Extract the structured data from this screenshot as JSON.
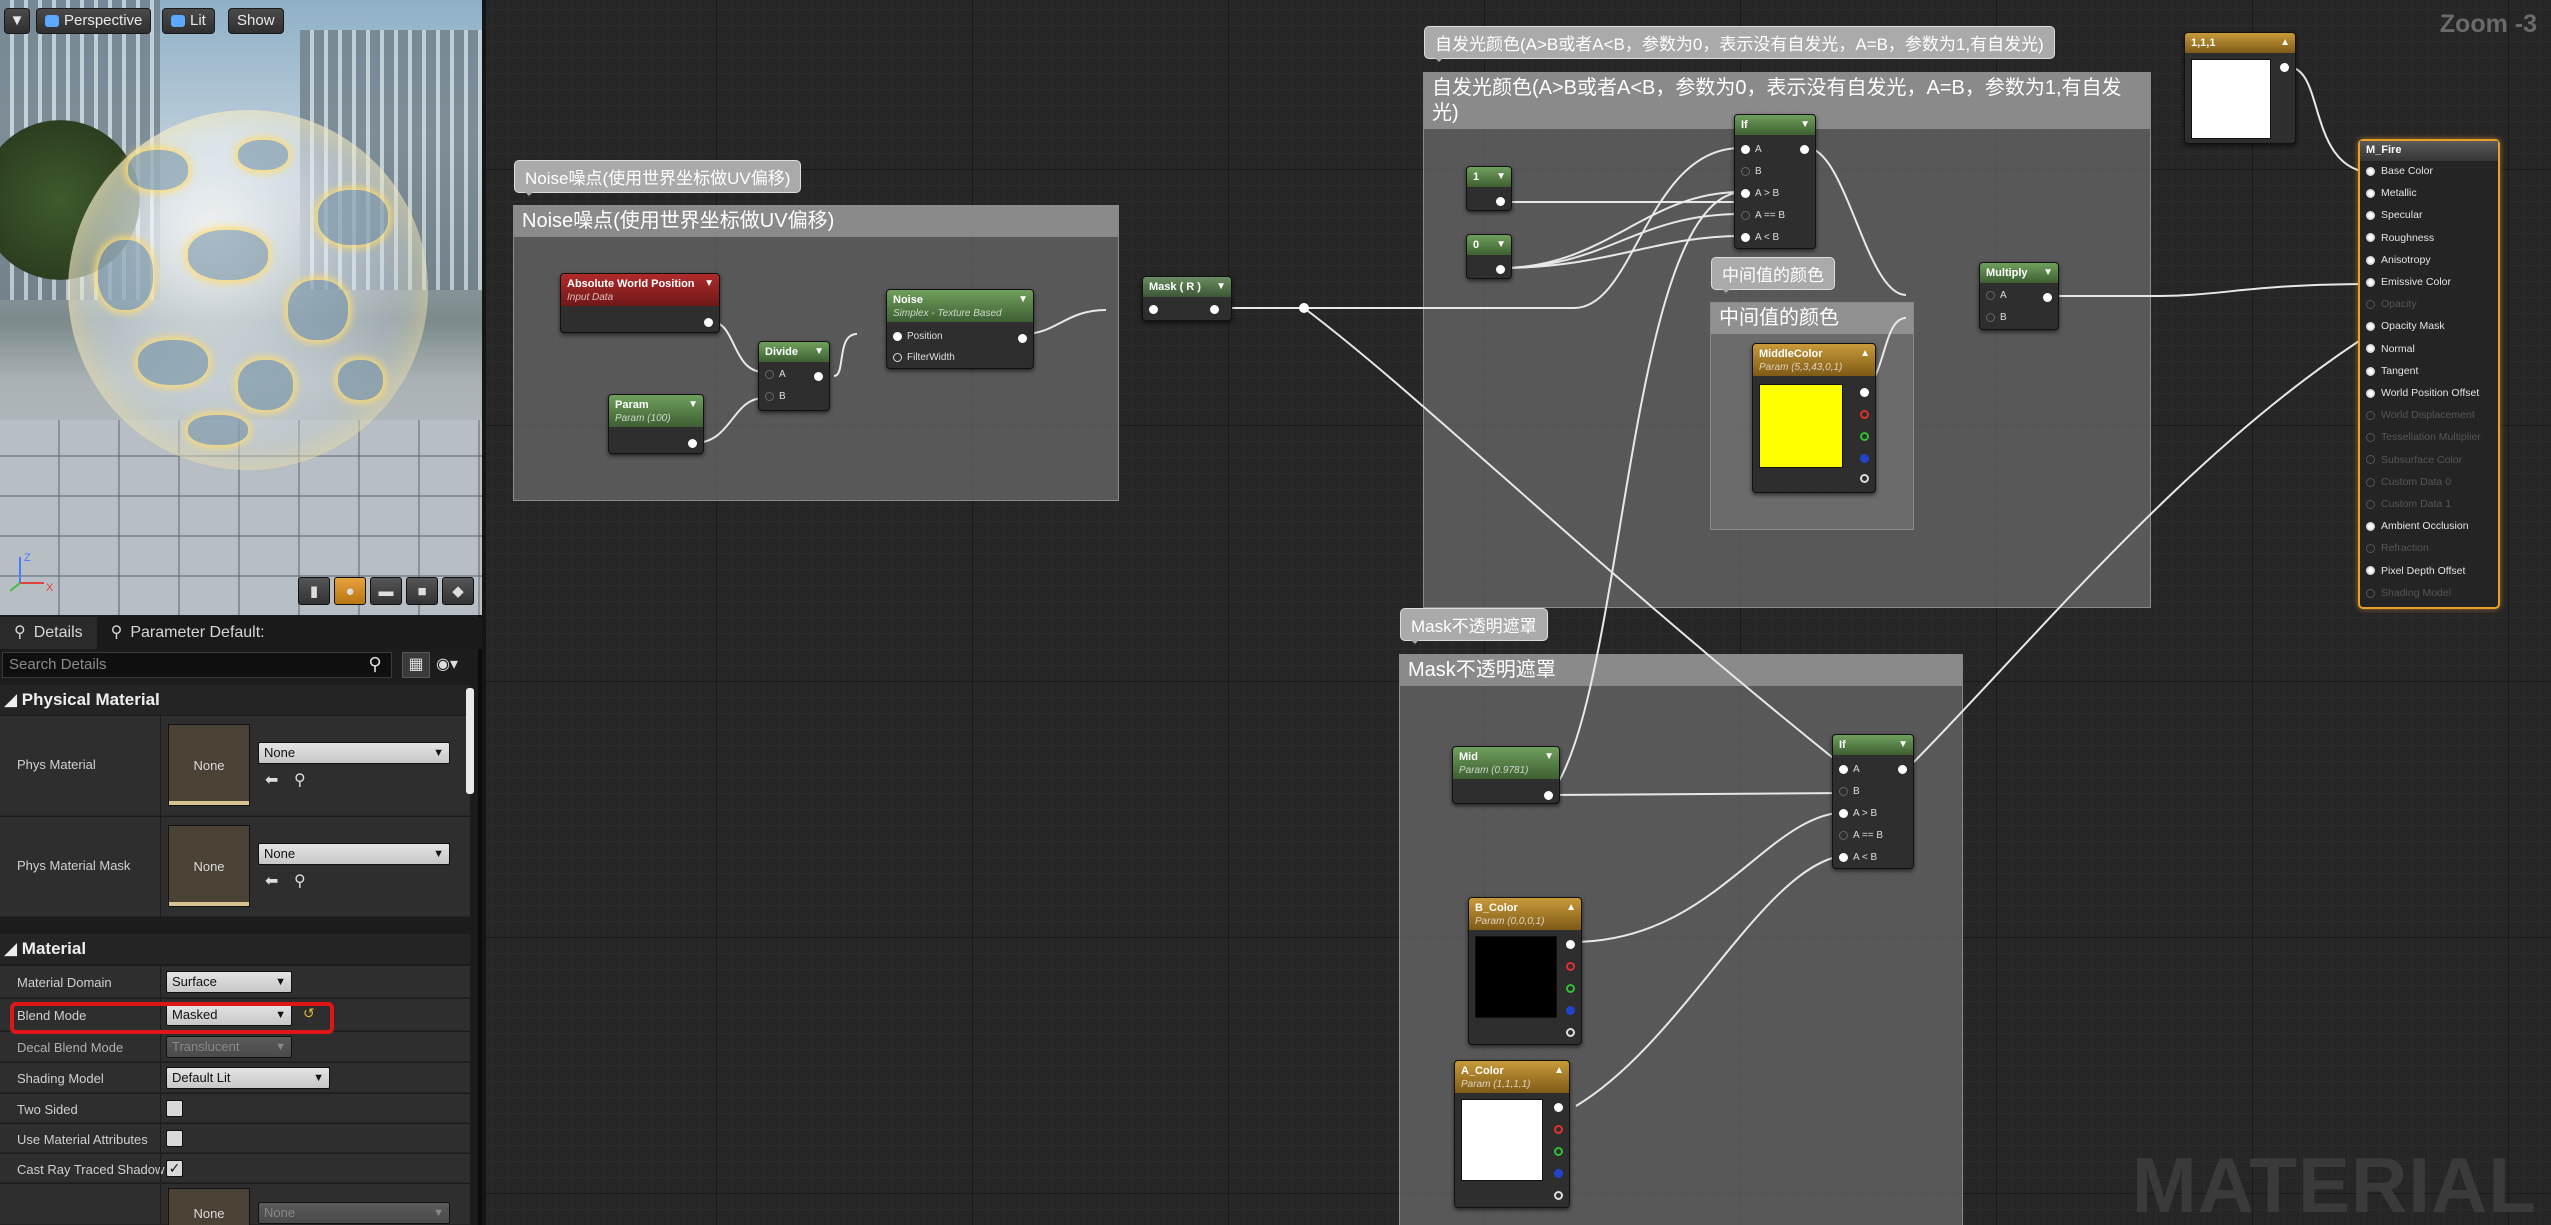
{
  "viewport": {
    "buttons": {
      "menu": "▼",
      "perspective": "Perspective",
      "lit": "Lit",
      "show": "Show"
    },
    "axes": {
      "z": "Z",
      "x": "X"
    }
  },
  "details": {
    "tabs": [
      {
        "label": "Details",
        "icon": "magnifier-icon"
      },
      {
        "label": "Parameter Default:",
        "icon": "magnifier-icon"
      }
    ],
    "search_placeholder": "Search Details",
    "physical_material": {
      "title": "Physical Material",
      "rows": [
        {
          "label": "Phys Material",
          "thumb": "None",
          "value": "None"
        },
        {
          "label": "Phys Material Mask",
          "thumb": "None",
          "value": "None"
        }
      ]
    },
    "material": {
      "title": "Material",
      "material_domain": {
        "label": "Material Domain",
        "value": "Surface"
      },
      "blend_mode": {
        "label": "Blend Mode",
        "value": "Masked",
        "reset": "↺"
      },
      "decal_blend_mode": {
        "label": "Decal Blend Mode",
        "value": "Translucent"
      },
      "shading_model": {
        "label": "Shading Model",
        "value": "Default Lit"
      },
      "two_sided": {
        "label": "Two Sided",
        "checked": false
      },
      "use_material_attributes": {
        "label": "Use Material Attributes",
        "checked": false
      },
      "cast_ray_traced_shadows": {
        "label": "Cast Ray Traced Shadow",
        "checked": true,
        "mark": "✓"
      },
      "partial_row": {
        "thumb": "None",
        "value": "None"
      }
    }
  },
  "graph": {
    "zoom": "Zoom -3",
    "watermark": "MATERIAL",
    "comments": {
      "noise": {
        "tag": "Noise噪点(使用世界坐标做UV偏移)",
        "header": "Noise噪点(使用世界坐标做UV偏移)"
      },
      "emissive": {
        "tag": "自发光颜色(A>B或者A<B，参数为0，表示没有自发光，A=B，参数为1,有自发光)",
        "header": "自发光颜色(A>B或者A<B，参数为0，表示没有自发光，A=B，参数为1,有自发光)"
      },
      "middle": {
        "tag": "中间值的颜色",
        "header": "中间值的颜色"
      },
      "mask": {
        "tag": "Mask不透明遮罩",
        "header": "Mask不透明遮罩"
      }
    },
    "nodes": {
      "abs_world_pos": {
        "title": "Absolute World Position",
        "sub": "Input Data"
      },
      "param": {
        "title": "Param",
        "sub": "Param (100)"
      },
      "divide": {
        "title": "Divide",
        "pins": [
          "A",
          "B"
        ]
      },
      "noise": {
        "title": "Noise",
        "sub": "Simplex - Texture Based",
        "pins": [
          "Position",
          "FilterWidth"
        ]
      },
      "mask_r": {
        "title": "Mask ( R )"
      },
      "const_1": {
        "title": "1"
      },
      "const_0": {
        "title": "0"
      },
      "if_top": {
        "title": "If",
        "pins": [
          "A",
          "B",
          "A > B",
          "A == B",
          "A < B"
        ]
      },
      "multiply": {
        "title": "Multiply",
        "pins": [
          "A",
          "B"
        ]
      },
      "middle_color": {
        "title": "MiddleColor",
        "sub": "Param (5,3,43,0,1)",
        "swatch": "#ffff00"
      },
      "const_111": {
        "title": "1,1,1",
        "swatch": "#ffffff"
      },
      "mid": {
        "title": "Mid",
        "sub": "Param (0.9781)"
      },
      "b_color": {
        "title": "B_Color",
        "sub": "Param (0,0,0,1)",
        "swatch": "#000000"
      },
      "a_color": {
        "title": "A_Color",
        "sub": "Param (1,1,1,1)",
        "swatch": "#ffffff"
      },
      "if_bottom": {
        "title": "If",
        "pins": [
          "A",
          "B",
          "A > B",
          "A == B",
          "A < B"
        ]
      }
    },
    "result": {
      "title": "M_Fire",
      "pins": [
        {
          "label": "Base Color",
          "active": true
        },
        {
          "label": "Metallic",
          "active": true
        },
        {
          "label": "Specular",
          "active": true
        },
        {
          "label": "Roughness",
          "active": true
        },
        {
          "label": "Anisotropy",
          "active": true
        },
        {
          "label": "Emissive Color",
          "active": true
        },
        {
          "label": "Opacity",
          "active": false
        },
        {
          "label": "Opacity Mask",
          "active": true
        },
        {
          "label": "Normal",
          "active": true
        },
        {
          "label": "Tangent",
          "active": true
        },
        {
          "label": "World Position Offset",
          "active": true
        },
        {
          "label": "World Displacement",
          "active": false
        },
        {
          "label": "Tessellation Multiplier",
          "active": false
        },
        {
          "label": "Subsurface Color",
          "active": false
        },
        {
          "label": "Custom Data 0",
          "active": false
        },
        {
          "label": "Custom Data 1",
          "active": false
        },
        {
          "label": "Ambient Occlusion",
          "active": true
        },
        {
          "label": "Refraction",
          "active": false
        },
        {
          "label": "Pixel Depth Offset",
          "active": true
        },
        {
          "label": "Shading Model",
          "active": false
        }
      ]
    }
  }
}
